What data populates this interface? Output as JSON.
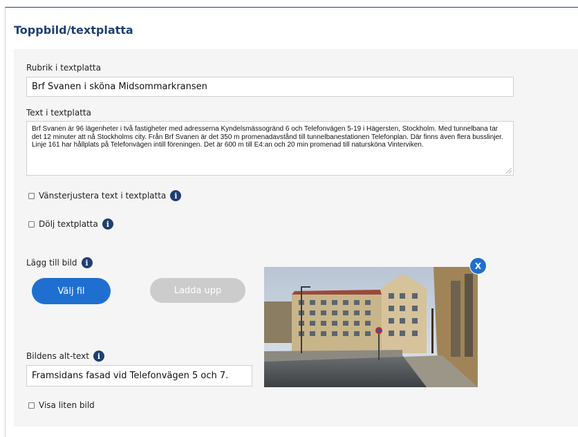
{
  "section": {
    "title": "Toppbild/textplatta"
  },
  "heading_field": {
    "label": "Rubrik i textplatta",
    "value": "Brf Svanen i sköna Midsommarkransen"
  },
  "text_field": {
    "label": "Text i textplatta",
    "value": "Brf Svanen är 96 lägenheter i två fastigheter med adresserna Kyndelsmässogränd 6 och Telefonvägen 5-19 i Hägersten, Stockholm. Med tunnelbana tar det 12 minuter att nå Stockholms city. Från Brf Svanen är det 350 m promenadavstånd till tunnelbanestationen Telefonplan. Där finns även flera busslinjer. Linje 161 har hållplats på Telefonvägen intill föreningen. Det är 600 m till E4:an och 20 min promenad till natursköna Vinterviken."
  },
  "options": {
    "left_align_label": "Vänsterjustera text i textplatta",
    "hide_plate_label": "Dölj textplatta",
    "small_image_label": "Visa liten bild"
  },
  "image": {
    "add_label": "Lägg till bild",
    "choose_file_button": "Välj fil",
    "upload_button": "Ladda upp",
    "remove_button": "X",
    "alt_label": "Bildens alt-text",
    "alt_value": "Framsidans fasad vid Telefonvägen 5 och 7."
  },
  "icons": {
    "info": "info-icon",
    "close": "close-icon",
    "checkbox": "checkbox-icon"
  },
  "colors": {
    "title": "#1f3f73",
    "primary": "#1f6fd1",
    "disabled": "#cccccc",
    "info": "#1f3f73",
    "panel": "#f5f5f5"
  }
}
